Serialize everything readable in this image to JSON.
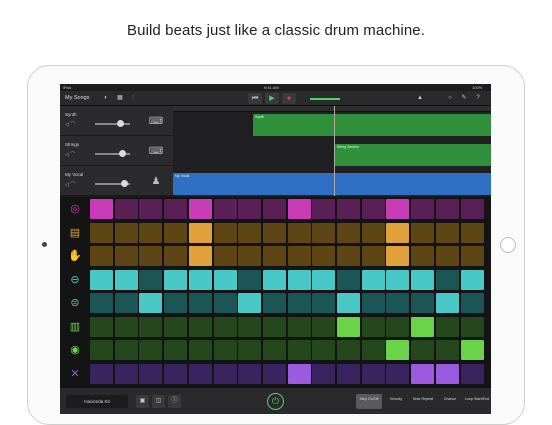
{
  "headline": "Build beats just like a classic drum machine.",
  "status": {
    "device": "iPad",
    "time": "9:41 AM",
    "battery": "100%"
  },
  "toolbar": {
    "my_songs": "My Songs"
  },
  "tracks": [
    {
      "name": "Synth",
      "instrument_icon": "keyboard-icon"
    },
    {
      "name": "Strings",
      "instrument_icon": "keyboard-icon"
    },
    {
      "name": "My Vocal",
      "instrument_icon": "microphone-icon"
    }
  ],
  "regions": [
    {
      "label": "Synth",
      "color": "#2f8f3a"
    },
    {
      "label": "String Section",
      "color": "#2f8f3a"
    },
    {
      "label": "My Vocal",
      "color": "#2f6fc4"
    }
  ],
  "pad_rows": [
    {
      "icon": "crash-cymbal-icon",
      "on_color": "#c83cb8",
      "off_color": "#5a1f55",
      "steps": [
        1,
        0,
        0,
        0,
        1,
        0,
        0,
        0,
        1,
        0,
        0,
        0,
        1,
        0,
        0,
        0
      ]
    },
    {
      "icon": "snare-drum-icon",
      "on_color": "#e0a13a",
      "off_color": "#5e4516",
      "steps": [
        0,
        0,
        0,
        0,
        1,
        0,
        0,
        0,
        0,
        0,
        0,
        0,
        1,
        0,
        0,
        0
      ]
    },
    {
      "icon": "clap-icon",
      "on_color": "#e0a13a",
      "off_color": "#5e4516",
      "steps": [
        0,
        0,
        0,
        0,
        1,
        0,
        0,
        0,
        0,
        0,
        0,
        0,
        1,
        0,
        0,
        0
      ]
    },
    {
      "icon": "hihat-closed-icon",
      "on_color": "#49c8c8",
      "off_color": "#1c5555",
      "steps": [
        1,
        1,
        0,
        1,
        1,
        1,
        0,
        1,
        1,
        1,
        0,
        1,
        1,
        1,
        0,
        1
      ]
    },
    {
      "icon": "hihat-open-icon",
      "on_color": "#49c8c8",
      "off_color": "#1c5555",
      "steps": [
        0,
        0,
        1,
        0,
        0,
        0,
        1,
        0,
        0,
        0,
        1,
        0,
        0,
        0,
        1,
        0
      ]
    },
    {
      "icon": "tom-icon",
      "on_color": "#6bd34a",
      "off_color": "#24481c",
      "steps": [
        0,
        0,
        0,
        0,
        0,
        0,
        0,
        0,
        0,
        0,
        1,
        0,
        0,
        1,
        0,
        0
      ]
    },
    {
      "icon": "kick-drum-icon",
      "on_color": "#6bd34a",
      "off_color": "#24481c",
      "steps": [
        0,
        0,
        0,
        0,
        0,
        0,
        0,
        0,
        0,
        0,
        0,
        0,
        1,
        0,
        0,
        1
      ]
    },
    {
      "icon": "sticks-icon",
      "on_color": "#9b5ae0",
      "off_color": "#3a2460",
      "steps": [
        0,
        0,
        0,
        0,
        0,
        0,
        0,
        0,
        1,
        0,
        0,
        0,
        0,
        1,
        1,
        0
      ]
    }
  ],
  "bottom": {
    "kit_name": "Hacienda Kit",
    "modes": [
      {
        "label": "Step On/Off",
        "active": true
      },
      {
        "label": "Velocity",
        "active": false
      },
      {
        "label": "Note Repeat",
        "active": false
      },
      {
        "label": "Chance",
        "active": false
      },
      {
        "label": "Loop Start/End",
        "active": false
      }
    ]
  }
}
